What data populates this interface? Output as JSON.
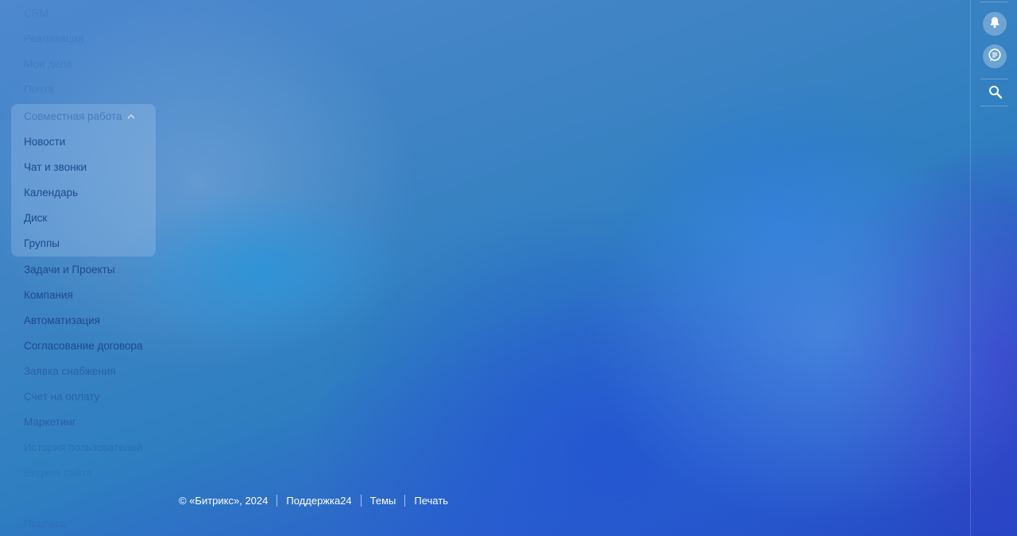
{
  "sidebar": {
    "items_top": [
      "CRM",
      "Реализация",
      "Мои дела",
      "Почта"
    ],
    "group": {
      "label": "Совместная работа",
      "items": [
        "Новости",
        "Чат и звонки",
        "Календарь",
        "Диск",
        "Группы"
      ]
    },
    "items_bottom": [
      "Задачи и Проекты",
      "Компания",
      "Автоматизация",
      "Согласование договора",
      "Заявка снабжения",
      "Счет на оплату",
      "Маркетинг",
      "История пользователей",
      "Виджет сайта",
      "Подпись"
    ]
  },
  "footer": {
    "copyright": "© «Битрикс», 2024",
    "support": "Поддержка24",
    "themes": "Темы",
    "print": "Печать"
  },
  "rightbar": {
    "icons": [
      "bell-icon",
      "chat-icon",
      "search-icon"
    ]
  }
}
